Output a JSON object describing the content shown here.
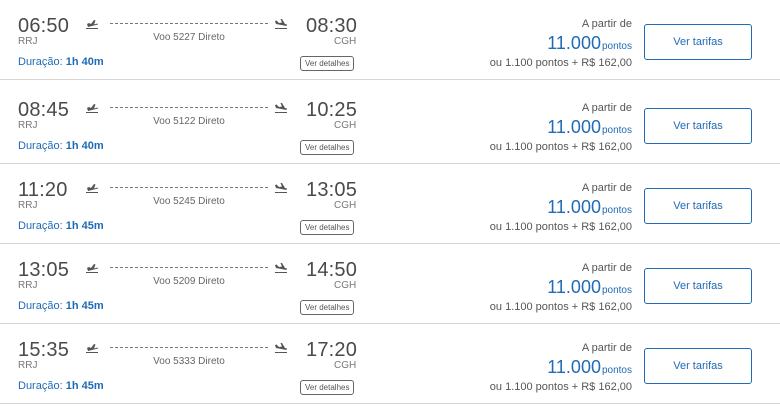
{
  "flights": [
    {
      "departure_time": "06:50",
      "departure_code": "RRJ",
      "arrival_time": "08:30",
      "arrival_code": "CGH",
      "flight_info": "Voo 5227 Direto",
      "duration_label": "Duração:",
      "duration_value": "1h 40m",
      "details_label": "Ver detalhes",
      "from_label": "A partir de",
      "points_value": "11.000",
      "points_unit": "pontos",
      "alt_price": "ou 1.100 pontos + R$ 162,00",
      "fares_label": "Ver tarifas"
    },
    {
      "departure_time": "08:45",
      "departure_code": "RRJ",
      "arrival_time": "10:25",
      "arrival_code": "CGH",
      "flight_info": "Voo 5122 Direto",
      "duration_label": "Duração:",
      "duration_value": "1h 40m",
      "details_label": "Ver detalhes",
      "from_label": "A partir de",
      "points_value": "11.000",
      "points_unit": "pontos",
      "alt_price": "ou 1.100 pontos + R$ 162,00",
      "fares_label": "Ver tarifas"
    },
    {
      "departure_time": "11:20",
      "departure_code": "RRJ",
      "arrival_time": "13:05",
      "arrival_code": "CGH",
      "flight_info": "Voo 5245 Direto",
      "duration_label": "Duração:",
      "duration_value": "1h 45m",
      "details_label": "Ver detalhes",
      "from_label": "A partir de",
      "points_value": "11.000",
      "points_unit": "pontos",
      "alt_price": "ou 1.100 pontos + R$ 162,00",
      "fares_label": "Ver tarifas"
    },
    {
      "departure_time": "13:05",
      "departure_code": "RRJ",
      "arrival_time": "14:50",
      "arrival_code": "CGH",
      "flight_info": "Voo 5209 Direto",
      "duration_label": "Duração:",
      "duration_value": "1h 45m",
      "details_label": "Ver detalhes",
      "from_label": "A partir de",
      "points_value": "11.000",
      "points_unit": "pontos",
      "alt_price": "ou 1.100 pontos + R$ 162,00",
      "fares_label": "Ver tarifas"
    },
    {
      "departure_time": "15:35",
      "departure_code": "RRJ",
      "arrival_time": "17:20",
      "arrival_code": "CGH",
      "flight_info": "Voo 5333 Direto",
      "duration_label": "Duração:",
      "duration_value": "1h 45m",
      "details_label": "Ver detalhes",
      "from_label": "A partir de",
      "points_value": "11.000",
      "points_unit": "pontos",
      "alt_price": "ou 1.100 pontos + R$ 162,00",
      "fares_label": "Ver tarifas"
    }
  ],
  "icons": {
    "departure": "plane-takeoff-icon",
    "arrival": "plane-landing-icon"
  },
  "colors": {
    "accent": "#1f6bb5",
    "text": "#4a4a4a",
    "divider": "#d6d6d6"
  }
}
